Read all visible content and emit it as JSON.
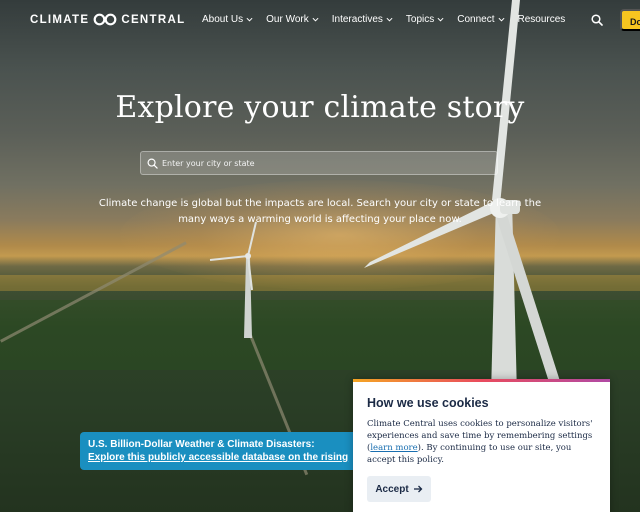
{
  "brand": {
    "logo_left": "CLIMATE",
    "logo_right": "CENTRAL"
  },
  "nav": {
    "items": [
      {
        "label": "About Us",
        "has_menu": true
      },
      {
        "label": "Our Work",
        "has_menu": true
      },
      {
        "label": "Interactives",
        "has_menu": true
      },
      {
        "label": "Topics",
        "has_menu": true
      },
      {
        "label": "Connect",
        "has_menu": true
      },
      {
        "label": "Resources",
        "has_menu": false
      }
    ],
    "search_icon": "search-icon",
    "donate_label": "Donate"
  },
  "hero": {
    "title": "Explore your climate story",
    "search_placeholder": "Enter your city or state",
    "description": "Climate change is global but the impacts are local. Search your city or state to learn the many ways a warming world is affecting your place now."
  },
  "banner": {
    "title": "U.S. Billion-Dollar Weather & Climate Disasters:",
    "link": "Explore this publicly accessible database on the rising"
  },
  "cookie": {
    "title": "How we use cookies",
    "text_before": "Climate Central uses cookies to personalize visitors' experiences and save time by remembering settings (",
    "link": "learn more",
    "text_after": "). By continuing to use our site, you accept this policy.",
    "accept_label": "Accept"
  },
  "colors": {
    "accent": "#f7c520",
    "banner": "#1a8fc0",
    "cookie_text": "#1b2a45"
  }
}
